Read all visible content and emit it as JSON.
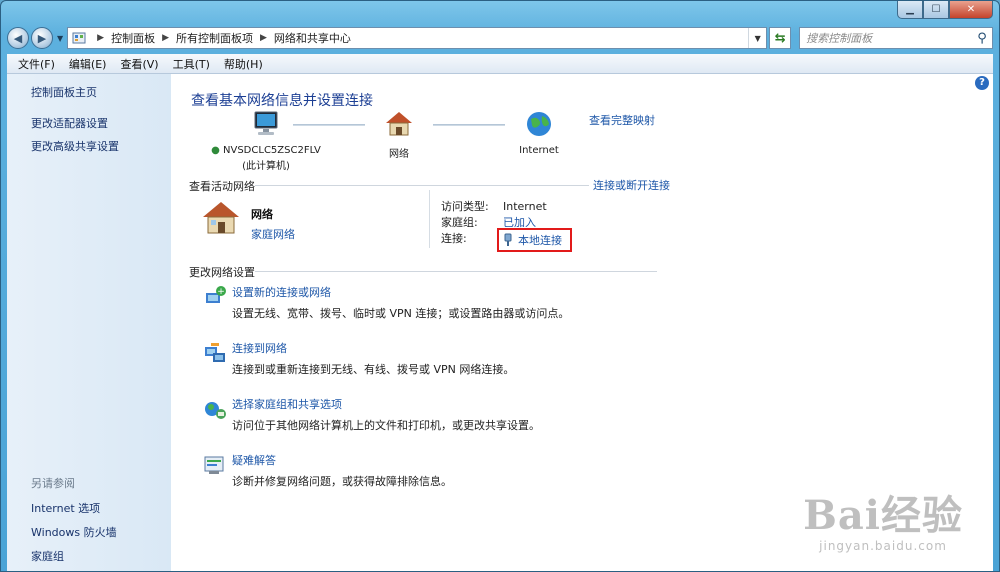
{
  "window": {
    "minimize_glyph": "▁",
    "maximize_glyph": "☐",
    "close_glyph": "✕"
  },
  "address": {
    "crumbs": [
      "控制面板",
      "所有控制面板项",
      "网络和共享中心"
    ],
    "search_placeholder": "搜索控制面板"
  },
  "menu": [
    "文件(F)",
    "编辑(E)",
    "查看(V)",
    "工具(T)",
    "帮助(H)"
  ],
  "sidebar": {
    "home": "控制面板主页",
    "items": [
      "更改适配器设置",
      "更改高级共享设置"
    ],
    "see_also_header": "另请参阅",
    "see_also": [
      "Internet 选项",
      "Windows 防火墙",
      "家庭组"
    ]
  },
  "main": {
    "title": "查看基本网络信息并设置连接",
    "view_full_map": "查看完整映射",
    "map": {
      "computer_name": "NVSDCLC5ZSC2FLV",
      "computer_sub": "(此计算机)",
      "network": "网络",
      "internet": "Internet"
    },
    "active_header": "查看活动网络",
    "connect_disconnect": "连接或断开连接",
    "active_network": {
      "name": "网络",
      "type": "家庭网络",
      "access_type_label": "访问类型:",
      "access_type_value": "Internet",
      "homegroup_label": "家庭组:",
      "homegroup_value": "已加入",
      "connection_label": "连接:",
      "connection_value": "本地连接"
    },
    "change_header": "更改网络设置",
    "tasks": [
      {
        "title": "设置新的连接或网络",
        "desc": "设置无线、宽带、拨号、临时或 VPN 连接；或设置路由器或访问点。"
      },
      {
        "title": "连接到网络",
        "desc": "连接到或重新连接到无线、有线、拨号或 VPN 网络连接。"
      },
      {
        "title": "选择家庭组和共享选项",
        "desc": "访问位于其他网络计算机上的文件和打印机，或更改共享设置。"
      },
      {
        "title": "疑难解答",
        "desc": "诊断并修复网络问题，或获得故障排除信息。"
      }
    ],
    "help_glyph": "?"
  },
  "watermark": {
    "brand": "Bai经验",
    "url": "jingyan.baidu.com"
  },
  "colors": {
    "link": "#1e57a8",
    "title": "#1c3f94",
    "highlight_box": "#e21a1a"
  }
}
